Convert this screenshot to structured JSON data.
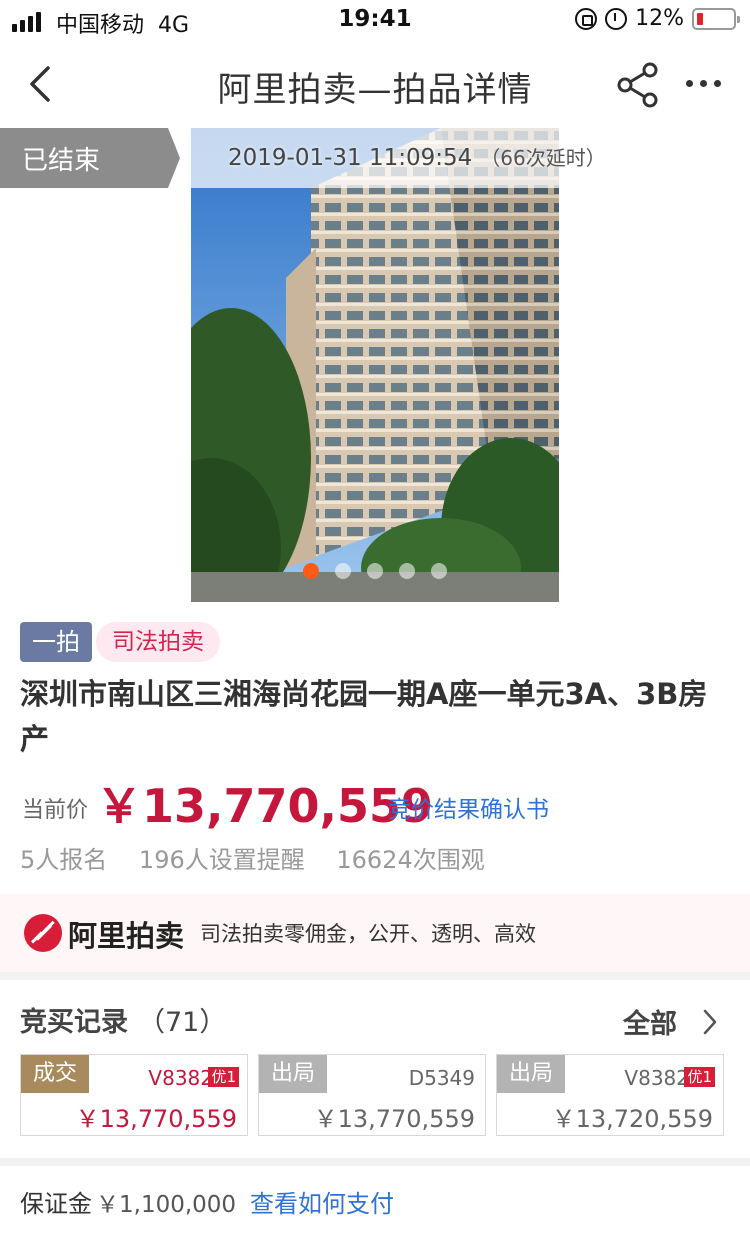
{
  "status_bar": {
    "carrier": "中国移动",
    "network": "4G",
    "time": "19:41",
    "battery_percent": "12%",
    "icons": [
      "signal-icon",
      "rotation-lock-icon",
      "alarm-icon",
      "battery-icon"
    ]
  },
  "nav": {
    "title": "阿里拍卖—拍品详情",
    "icons": [
      "back-icon",
      "share-icon",
      "more-icon"
    ]
  },
  "auction_status": {
    "label": "已结束",
    "end_time": "2019-01-31 11:09:54",
    "delay_note": "（66次延时）"
  },
  "gallery": {
    "image_count": 5,
    "active_index": 0,
    "image_description_icon": "building-photo"
  },
  "item": {
    "round_tag": "一拍",
    "type_tag": "司法拍卖",
    "title": "深圳市南山区三湘海尚花园一期A座一单元3A、3B房产",
    "price_label": "当前价",
    "price": "￥13,770,559",
    "confirm_link": "竞价结果确认书",
    "stats": {
      "signups": "5人报名",
      "reminders": "196人设置提醒",
      "views": "16624次围观"
    }
  },
  "promo": {
    "logo_text": "阿里拍卖",
    "slogan": "司法拍卖零佣金，公开、透明、高效"
  },
  "bid_records": {
    "title": "竞买记录",
    "count": "（71）",
    "all_label": "全部",
    "records": [
      {
        "status": "成交",
        "user": "V8382",
        "vip": "优1",
        "amount": "￥13,770,559"
      },
      {
        "status": "出局",
        "user": "D5349",
        "vip": "",
        "amount": "￥13,770,559"
      },
      {
        "status": "出局",
        "user": "V8382",
        "vip": "优1",
        "amount": "￥13,720,559"
      }
    ]
  },
  "deposit": {
    "label": "保证金",
    "amount": "￥1,100,000",
    "link": "查看如何支付"
  },
  "colors": {
    "price_red": "#c5173c",
    "link_blue": "#3073d6",
    "won_gold": "#a98a5c",
    "dot_active": "#ff5b14",
    "round_tag_bg": "#6b7aa3"
  }
}
